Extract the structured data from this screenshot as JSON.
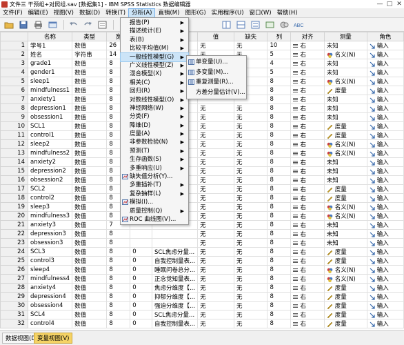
{
  "window": {
    "title": "文件三 干预组+对照组.sav [数据集1] - IBM SPSS Statistics 数据编辑器",
    "controls": [
      "—",
      "□",
      "✕"
    ]
  },
  "menubar": [
    {
      "label": "文件(F)"
    },
    {
      "label": "编辑(E)"
    },
    {
      "label": "视图(V)"
    },
    {
      "label": "数据(D)"
    },
    {
      "label": "转换(T)"
    },
    {
      "label": "分析(A)",
      "active": true
    },
    {
      "label": "直销(M)"
    },
    {
      "label": "图形(G)"
    },
    {
      "label": "实用程序(U)"
    },
    {
      "label": "窗口(W)"
    },
    {
      "label": "帮助(H)"
    }
  ],
  "grid": {
    "headers": [
      "",
      "名称",
      "类型",
      "宽",
      "",
      "",
      "值",
      "缺失",
      "列",
      "对齐",
      "测量",
      "角色"
    ],
    "rows": [
      {
        "n": "1",
        "name": "学号1",
        "type": "数值",
        "w": "26",
        "val": "无",
        "miss": "无",
        "col": "10",
        "align": "右",
        "meas": "未知",
        "mi": "unknown",
        "role": "输入"
      },
      {
        "n": "2",
        "name": "姓名",
        "type": "字符串",
        "w": "14",
        "val": "无",
        "miss": "无",
        "col": "5",
        "align": "右",
        "meas": "名义(N)",
        "mi": "nominal",
        "role": "输入"
      },
      {
        "n": "3",
        "name": "grade1",
        "type": "数值",
        "w": "8",
        "val": "",
        "miss": "",
        "col": "4",
        "align": "右",
        "meas": "未知",
        "mi": "unknown",
        "role": "输入"
      },
      {
        "n": "4",
        "name": "gender1",
        "type": "数值",
        "w": "8",
        "val": "",
        "miss": "",
        "col": "5",
        "align": "右",
        "meas": "未知",
        "mi": "unknown",
        "role": "输入"
      },
      {
        "n": "5",
        "name": "sleep1",
        "type": "数值",
        "w": "8",
        "val": "",
        "miss": "",
        "col": "8",
        "align": "右",
        "meas": "名义(N)",
        "mi": "nominal",
        "role": "输入"
      },
      {
        "n": "6",
        "name": "mindfulness1",
        "type": "数值",
        "w": "8",
        "val": "",
        "miss": "",
        "col": "8",
        "align": "右",
        "meas": "度量",
        "mi": "scale",
        "role": "输入"
      },
      {
        "n": "7",
        "name": "anxiety1",
        "type": "数值",
        "w": "8",
        "val": "",
        "miss": "",
        "col": "8",
        "align": "右",
        "meas": "未知",
        "mi": "unknown",
        "role": "输入"
      },
      {
        "n": "8",
        "name": "depression1",
        "type": "数值",
        "w": "8",
        "val": "无",
        "miss": "无",
        "col": "8",
        "align": "右",
        "meas": "未知",
        "mi": "unknown",
        "role": "输入"
      },
      {
        "n": "9",
        "name": "obsession1",
        "type": "数值",
        "w": "8",
        "val": "无",
        "miss": "无",
        "col": "8",
        "align": "右",
        "meas": "未知",
        "mi": "unknown",
        "role": "输入"
      },
      {
        "n": "10",
        "name": "SCL1",
        "type": "数值",
        "w": "8",
        "val": "无",
        "miss": "无",
        "col": "8",
        "align": "右",
        "meas": "度量",
        "mi": "scale",
        "role": "输入"
      },
      {
        "n": "11",
        "name": "control1",
        "type": "数值",
        "w": "8",
        "val": "无",
        "miss": "无",
        "col": "8",
        "align": "右",
        "meas": "度量",
        "mi": "scale",
        "role": "输入"
      },
      {
        "n": "12",
        "name": "sleep2",
        "type": "数值",
        "w": "8",
        "val": "无",
        "miss": "无",
        "col": "8",
        "align": "右",
        "meas": "名义(N)",
        "mi": "nominal",
        "role": "输入"
      },
      {
        "n": "13",
        "name": "mindfulness2",
        "type": "数值",
        "w": "8",
        "val": "无",
        "miss": "无",
        "col": "8",
        "align": "右",
        "meas": "名义(N)",
        "mi": "nominal",
        "role": "输入"
      },
      {
        "n": "14",
        "name": "anxiety2",
        "type": "数值",
        "w": "8",
        "val": "无",
        "miss": "无",
        "col": "8",
        "align": "右",
        "meas": "未知",
        "mi": "unknown",
        "role": "输入"
      },
      {
        "n": "15",
        "name": "depression2",
        "type": "数值",
        "w": "8",
        "val": "无",
        "miss": "无",
        "col": "8",
        "align": "右",
        "meas": "未知",
        "mi": "unknown",
        "role": "输入"
      },
      {
        "n": "16",
        "name": "obsession2",
        "type": "数值",
        "w": "8",
        "val": "无",
        "miss": "无",
        "col": "8",
        "align": "右",
        "meas": "未知",
        "mi": "unknown",
        "role": "输入"
      },
      {
        "n": "17",
        "name": "SCL2",
        "type": "数值",
        "w": "8",
        "val": "无",
        "miss": "无",
        "col": "8",
        "align": "右",
        "meas": "度量",
        "mi": "scale",
        "role": "输入"
      },
      {
        "n": "18",
        "name": "control2",
        "type": "数值",
        "w": "8",
        "val": "无",
        "miss": "无",
        "col": "8",
        "align": "右",
        "meas": "度量",
        "mi": "scale",
        "role": "输入"
      },
      {
        "n": "19",
        "name": "sleep3",
        "type": "数值",
        "w": "8",
        "val": "无",
        "miss": "无",
        "col": "8",
        "align": "右",
        "meas": "名义(N)",
        "mi": "nominal",
        "role": "输入"
      },
      {
        "n": "20",
        "name": "mindfulness3",
        "type": "数值",
        "w": "8",
        "val": "无",
        "miss": "无",
        "col": "8",
        "align": "右",
        "meas": "名义(N)",
        "mi": "nominal",
        "role": "输入"
      },
      {
        "n": "21",
        "name": "anxiety3",
        "type": "数值",
        "w": "7",
        "val": "无",
        "miss": "无",
        "col": "8",
        "align": "右",
        "meas": "未知",
        "mi": "unknown",
        "role": "输入"
      },
      {
        "n": "22",
        "name": "depression3",
        "type": "数值",
        "w": "8",
        "val": "无",
        "miss": "无",
        "col": "8",
        "align": "右",
        "meas": "未知",
        "mi": "unknown",
        "role": "输入"
      },
      {
        "n": "23",
        "name": "obsession3",
        "type": "数值",
        "w": "8",
        "val": "无",
        "miss": "无",
        "col": "8",
        "align": "右",
        "meas": "未知",
        "mi": "unknown",
        "role": "输入"
      },
      {
        "n": "24",
        "name": "SCL3",
        "type": "数值",
        "w": "8",
        "dec": "0",
        "label": "SCL焦虑分量...",
        "val": "无",
        "miss": "无",
        "col": "8",
        "align": "右",
        "meas": "度量",
        "mi": "scale",
        "role": "输入"
      },
      {
        "n": "25",
        "name": "control3",
        "type": "数值",
        "w": "8",
        "dec": "0",
        "label": "自我控制量表...",
        "val": "无",
        "miss": "无",
        "col": "8",
        "align": "右",
        "meas": "度量",
        "mi": "scale",
        "role": "输入"
      },
      {
        "n": "26",
        "name": "sleep4",
        "type": "数值",
        "w": "8",
        "dec": "0",
        "label": "睡眠问卷总分...",
        "val": "无",
        "miss": "无",
        "col": "8",
        "align": "右",
        "meas": "名义(N)",
        "mi": "nominal",
        "role": "输入"
      },
      {
        "n": "27",
        "name": "mindfulness4",
        "type": "数值",
        "w": "8",
        "dec": "0",
        "label": "正念觉知量表...",
        "val": "无",
        "miss": "无",
        "col": "8",
        "align": "右",
        "meas": "名义(N)",
        "mi": "nominal",
        "role": "输入"
      },
      {
        "n": "28",
        "name": "anxiety4",
        "type": "数值",
        "w": "8",
        "dec": "0",
        "label": "焦虑分维度【...",
        "val": "无",
        "miss": "无",
        "col": "8",
        "align": "右",
        "meas": "度量",
        "mi": "scale",
        "role": "输入"
      },
      {
        "n": "29",
        "name": "depression4",
        "type": "数值",
        "w": "8",
        "dec": "0",
        "label": "抑郁分维度【...",
        "val": "无",
        "miss": "无",
        "col": "8",
        "align": "右",
        "meas": "度量",
        "mi": "scale",
        "role": "输入"
      },
      {
        "n": "30",
        "name": "obsession4",
        "type": "数值",
        "w": "8",
        "dec": "0",
        "label": "强迫分维度【...",
        "val": "无",
        "miss": "无",
        "col": "8",
        "align": "右",
        "meas": "度量",
        "mi": "scale",
        "role": "输入"
      },
      {
        "n": "31",
        "name": "SCL4",
        "type": "数值",
        "w": "8",
        "dec": "0",
        "label": "SCL焦虑分量...",
        "val": "无",
        "miss": "无",
        "col": "8",
        "align": "右",
        "meas": "度量",
        "mi": "scale",
        "role": "输入"
      },
      {
        "n": "32",
        "name": "control4",
        "type": "数值",
        "w": "8",
        "dec": "0",
        "label": "自我控制量表...",
        "val": "无",
        "miss": "无",
        "col": "8",
        "align": "右",
        "meas": "度量",
        "mi": "scale",
        "role": "输入"
      }
    ]
  },
  "analyze_menu": [
    {
      "label": "报告(P)",
      "sub": true
    },
    {
      "label": "描述统计(E)",
      "sub": true
    },
    {
      "label": "表(B)",
      "sub": true
    },
    {
      "label": "比较平均值(M)",
      "sub": true
    },
    {
      "label": "一般线性模型(G)",
      "sub": true,
      "hl": true
    },
    {
      "label": "广义线性模型(Z)",
      "sub": true
    },
    {
      "label": "混合模型(X)",
      "sub": true
    },
    {
      "label": "相关(C)",
      "sub": true
    },
    {
      "label": "回归(R)",
      "sub": true
    },
    {
      "label": "对数线性模型(O)",
      "sub": true
    },
    {
      "label": "神经网络(W)",
      "sub": true
    },
    {
      "label": "分类(F)",
      "sub": true
    },
    {
      "label": "降维(D)",
      "sub": true
    },
    {
      "label": "度量(A)",
      "sub": true
    },
    {
      "label": "非参数检验(N)",
      "sub": true
    },
    {
      "label": "预测(T)",
      "sub": true
    },
    {
      "label": "生存函数(S)",
      "sub": true
    },
    {
      "label": "多重响应(U)",
      "sub": true
    },
    {
      "label": "缺失值分析(Y)...",
      "sub": false,
      "icon": true
    },
    {
      "label": "多重插补(T)",
      "sub": true
    },
    {
      "label": "复杂抽样(L)",
      "sub": true
    },
    {
      "label": "模拟(I)...",
      "sub": false,
      "icon": true
    },
    {
      "label": "质量控制(Q)",
      "sub": true
    },
    {
      "label": "ROC 曲线图(V)...",
      "sub": false,
      "icon": true
    }
  ],
  "glm_submenu": [
    {
      "label": "单变量(U)...",
      "icon": true
    },
    {
      "label": "多变量(M)...",
      "icon": true
    },
    {
      "label": "重复测量(R)...",
      "icon": true
    },
    {
      "label": "方差分量估计(V)...",
      "icon": false
    }
  ],
  "tabs": [
    {
      "label": "数据视图(D)",
      "active": false
    },
    {
      "label": "变量视图(V)",
      "active": true
    }
  ],
  "colors": {
    "accent": "#cce4f7",
    "active_tab": "#f5d365",
    "nominal": "#d04040",
    "scale": "#c8a020"
  }
}
